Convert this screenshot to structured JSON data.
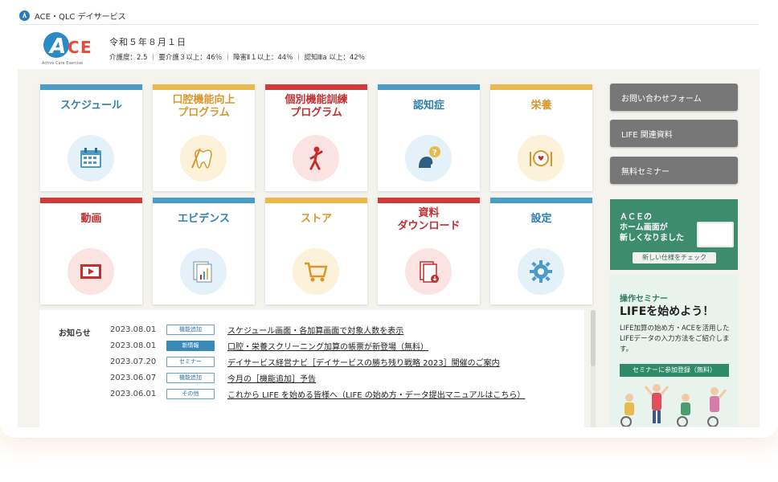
{
  "app": {
    "site_title": "ACE・QLC デイサービス",
    "logo_text": "ACE",
    "logo_tagline": "Active Care Exercise"
  },
  "header": {
    "date": "令和５年８月１日",
    "stats": "介護度：2.5 ｜ 要介護３以上：46％ ｜ 障害Ⅱ１以上：44％ ｜ 認知Ⅲa 以上：42％"
  },
  "colors": {
    "blue": "#4a9cc7",
    "yellow": "#eab94c",
    "red": "#cf3a3a",
    "panel": "#f4f3ee",
    "green": "#3e8c6e"
  },
  "tiles": [
    {
      "label": "スケジュール",
      "color": "#4a9cc7",
      "icon": "calendar-icon"
    },
    {
      "label": "口腔機能向上\nプログラム",
      "color": "#eab94c",
      "icon": "tooth-icon"
    },
    {
      "label": "個別機能訓練\nプログラム",
      "color": "#cf3a3a",
      "icon": "exercise-icon"
    },
    {
      "label": "認知症",
      "color": "#4a9cc7",
      "icon": "head-question-icon"
    },
    {
      "label": "栄養",
      "color": "#eab94c",
      "icon": "meal-icon"
    },
    {
      "label": "動画",
      "color": "#cf3a3a",
      "icon": "video-icon"
    },
    {
      "label": "エビデンス",
      "color": "#4a9cc7",
      "icon": "documents-chart-icon"
    },
    {
      "label": "ストア",
      "color": "#eab94c",
      "icon": "cart-icon"
    },
    {
      "label": "資料\nダウンロード",
      "color": "#cf3a3a",
      "icon": "download-doc-icon"
    },
    {
      "label": "設定",
      "color": "#4a9cc7",
      "icon": "gear-icon"
    }
  ],
  "sidebar": {
    "buttons": [
      {
        "label": "お問い合わせフォーム"
      },
      {
        "label": "LIFE 関連資料"
      },
      {
        "label": "無料セミナー"
      }
    ],
    "banner_home": {
      "text": "ＡＣＥの\nホーム画面が\n新しくなりました",
      "cta": "新しい仕様をチェック"
    },
    "banner_seminar": {
      "kicker": "操作セミナー",
      "title": "LIFEを始めよう！",
      "desc": "LIFE加算の始め方・ACEを活用したLIFEデータの入力方法をご紹介します。",
      "cta": "セミナーに参加登録（無料）"
    }
  },
  "news": {
    "heading": "お知らせ",
    "items": [
      {
        "date": "2023.08.01",
        "badge": "機能追加",
        "filled": false,
        "title": "スケジュール画面・各加算画面で対象人数を表示"
      },
      {
        "date": "2023.08.01",
        "badge": "新情報",
        "filled": true,
        "title": "口腔・栄養スクリーニング加算の帳票が新登場（無料）"
      },
      {
        "date": "2023.07.20",
        "badge": "セミナー",
        "filled": false,
        "title": "デイサービス経営ナビ［デイサービスの勝ち残り戦略 2023］開催のご案内"
      },
      {
        "date": "2023.06.07",
        "badge": "機能追加",
        "filled": false,
        "title": "今月の［機能追加］予告"
      },
      {
        "date": "2023.06.01",
        "badge": "その他",
        "filled": false,
        "title": "これから LIFE を始める皆様へ（LIFE の始め方・データ提出マニュアルはこちら）"
      }
    ]
  }
}
